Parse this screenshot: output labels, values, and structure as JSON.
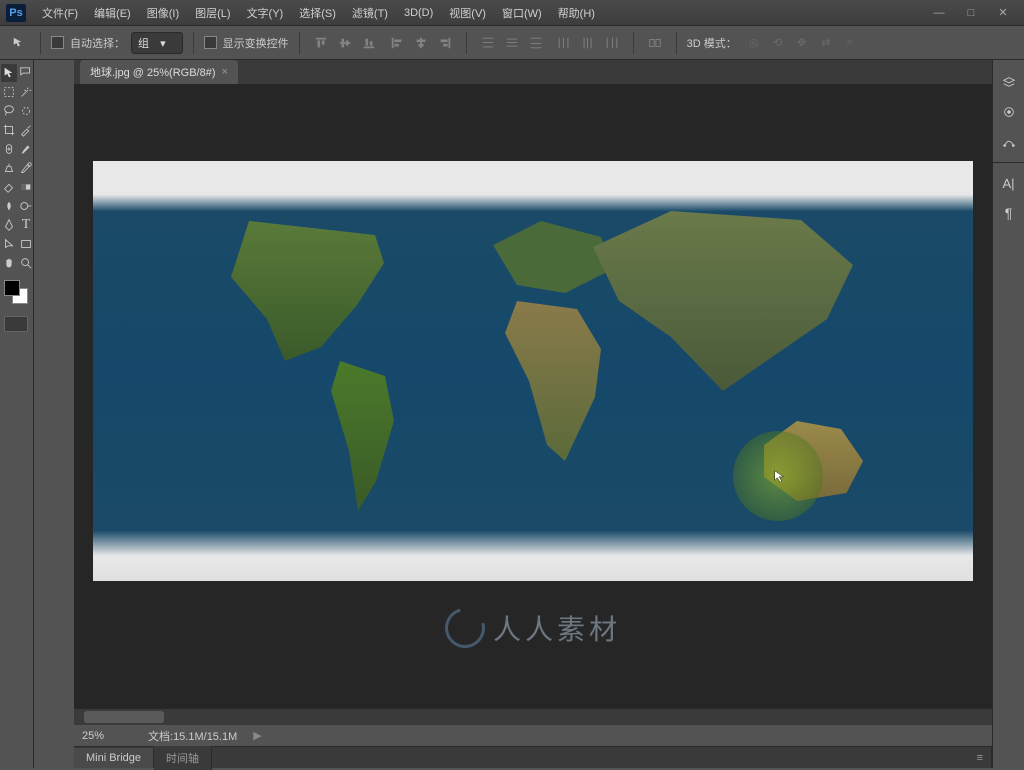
{
  "app": {
    "logo": "Ps"
  },
  "menu": {
    "items": [
      {
        "label": "文件(F)"
      },
      {
        "label": "编辑(E)"
      },
      {
        "label": "图像(I)"
      },
      {
        "label": "图层(L)"
      },
      {
        "label": "文字(Y)"
      },
      {
        "label": "选择(S)"
      },
      {
        "label": "滤镜(T)"
      },
      {
        "label": "3D(D)"
      },
      {
        "label": "视图(V)"
      },
      {
        "label": "窗口(W)"
      },
      {
        "label": "帮助(H)"
      }
    ]
  },
  "options": {
    "auto_select_label": "自动选择：",
    "auto_select_value": "组",
    "show_transform_label": "显示变换控件",
    "mode3d_label": "3D 模式："
  },
  "document": {
    "tab_title": "地球.jpg @ 25%(RGB/8#)",
    "close_glyph": "×"
  },
  "status": {
    "zoom": "25%",
    "doc_info_label": "文档:",
    "doc_info_value": "15.1M/15.1M",
    "arrow": "▶"
  },
  "bottom_tabs": {
    "t1": "Mini Bridge",
    "t2": "时间轴"
  },
  "window_ctrls": {
    "min": "—",
    "max": "□",
    "close": "✕"
  },
  "colors": {
    "fg": "#000000",
    "bg": "#ffffff"
  },
  "watermark": {
    "text": "人人素材"
  }
}
